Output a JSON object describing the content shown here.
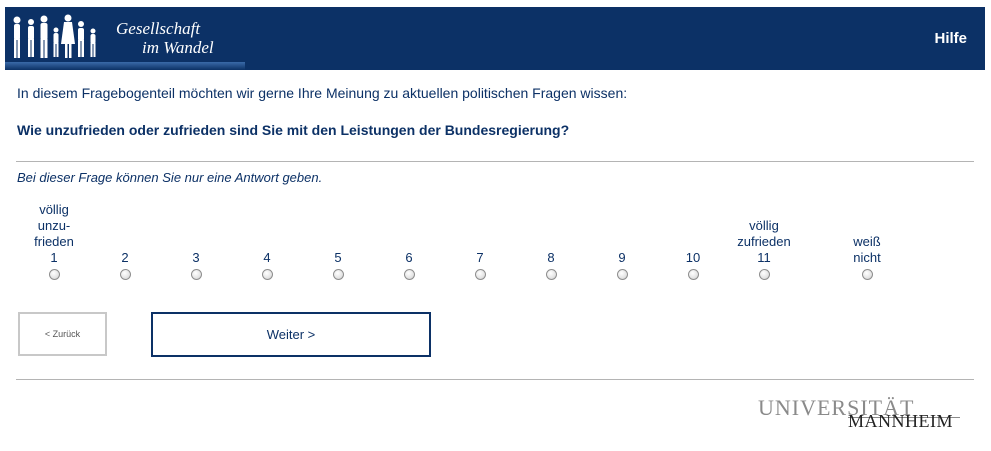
{
  "header": {
    "logo_line1": "Gesellschaft",
    "logo_line2": "im Wandel",
    "help_label": "Hilfe",
    "background_color": "#0c3166"
  },
  "intro_text": "In diesem Fragebogenteil möchten wir gerne Ihre Meinung zu aktuellen politischen Fragen wissen:",
  "question_text": "Wie unzufrieden oder zufrieden sind Sie mit den Leistungen der Bundesregierung?",
  "hint_text": "Bei dieser Frage können Sie nur eine Antwort geben.",
  "scale": {
    "options": [
      {
        "lines": [
          "völlig",
          "unzu-",
          "frieden",
          "1"
        ]
      },
      {
        "lines": [
          "2"
        ]
      },
      {
        "lines": [
          "3"
        ]
      },
      {
        "lines": [
          "4"
        ]
      },
      {
        "lines": [
          "5"
        ]
      },
      {
        "lines": [
          "6"
        ]
      },
      {
        "lines": [
          "7"
        ]
      },
      {
        "lines": [
          "8"
        ]
      },
      {
        "lines": [
          "9"
        ]
      },
      {
        "lines": [
          "10"
        ]
      },
      {
        "lines": [
          "völlig",
          "zufrieden",
          "11"
        ]
      },
      {
        "lines": [
          "weiß",
          "nicht"
        ]
      }
    ],
    "selected": null
  },
  "buttons": {
    "back_label": "< Zurück",
    "next_label": "Weiter >"
  },
  "footer": {
    "university_line1": "UNIVERSITÄT",
    "university_line2": "MANNHEIM"
  }
}
